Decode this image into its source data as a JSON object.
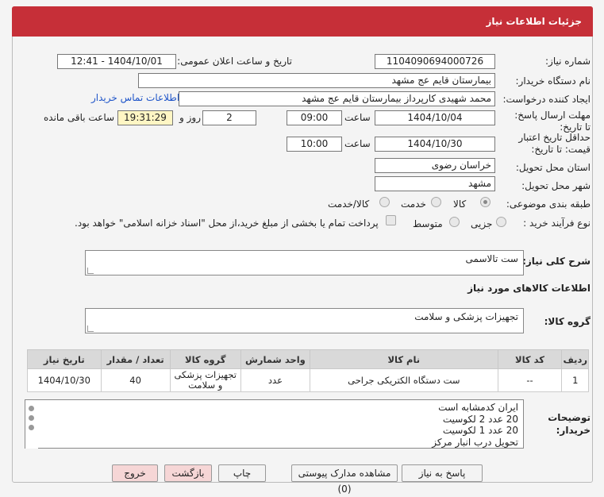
{
  "header": {
    "title": "جزئیات اطلاعات نیاز"
  },
  "fields": {
    "need_number_label": "شماره نیاز:",
    "need_number": "1104090694000726",
    "announce_label": "تاریخ و ساعت اعلان عمومی:",
    "announce_value": "1404/10/01 - 12:41",
    "buyer_org_label": "نام دستگاه خریدار:",
    "buyer_org": "بیمارستان قایم  عج  مشهد",
    "requester_label": "ایجاد کننده درخواست:",
    "requester": "محمد شهیدی کارپرداز بیمارستان قایم  عج  مشهد",
    "contact_link": "اطلاعات تماس خریدار",
    "reply_deadline_label": "مهلت ارسال پاسخ: تا تاریخ:",
    "reply_date": "1404/10/04",
    "hour_label": "ساعت",
    "reply_hour": "09:00",
    "days_value": "2",
    "days_label": "روز و",
    "remaining_time": "19:31:29",
    "remaining_label": "ساعت باقی مانده",
    "price_validity_label": "حداقل تاریخ اعتبار قیمت: تا تاریخ:",
    "price_date": "1404/10/30",
    "price_hour": "10:00",
    "province_label": "استان محل تحویل:",
    "province": "خراسان رضوی",
    "city_label": "شهر محل تحویل:",
    "city": "مشهد",
    "category_label": "طبقه بندی موضوعی:",
    "category_options": [
      "کالا",
      "خدمت",
      "کالا/خدمت"
    ],
    "process_label": "نوع فرآیند خرید :",
    "process_options": [
      "جزیی",
      "متوسط"
    ],
    "payment_note": "پرداخت تمام یا بخشی از مبلغ خرید،از محل \"اسناد خزانه اسلامی\" خواهد بود."
  },
  "description": {
    "label": "شرح کلی نیاز:",
    "value": "ست تالاسمی"
  },
  "goods_info_title": "اطلاعات کالاهای مورد نیاز",
  "goods_group": {
    "label": "گروه کالا:",
    "value": "تجهیزات پزشکی و سلامت"
  },
  "table": {
    "headers": [
      "ردیف",
      "کد کالا",
      "نام کالا",
      "واحد شمارش",
      "گروه کالا",
      "تعداد / مقدار",
      "تاریخ نیاز"
    ],
    "rows": [
      [
        "1",
        "--",
        "ست دستگاه الکتریکی جراحی",
        "عدد",
        "تجهیزات پزشکی و سلامت",
        "40",
        "1404/10/30"
      ]
    ]
  },
  "buyer_notes": {
    "label": "توضیحات خریدار:",
    "lines": [
      "ایران کدمشابه است",
      "20 عدد 2 لکوسیت",
      "20 عدد 1 لکوسیت",
      "تحویل درب انبار مرکز"
    ]
  },
  "buttons": {
    "reply": "پاسخ به نیاز",
    "docs": "مشاهده مدارک پیوستی (0)",
    "print": "چاپ",
    "back": "بازگشت",
    "exit": "خروج"
  }
}
